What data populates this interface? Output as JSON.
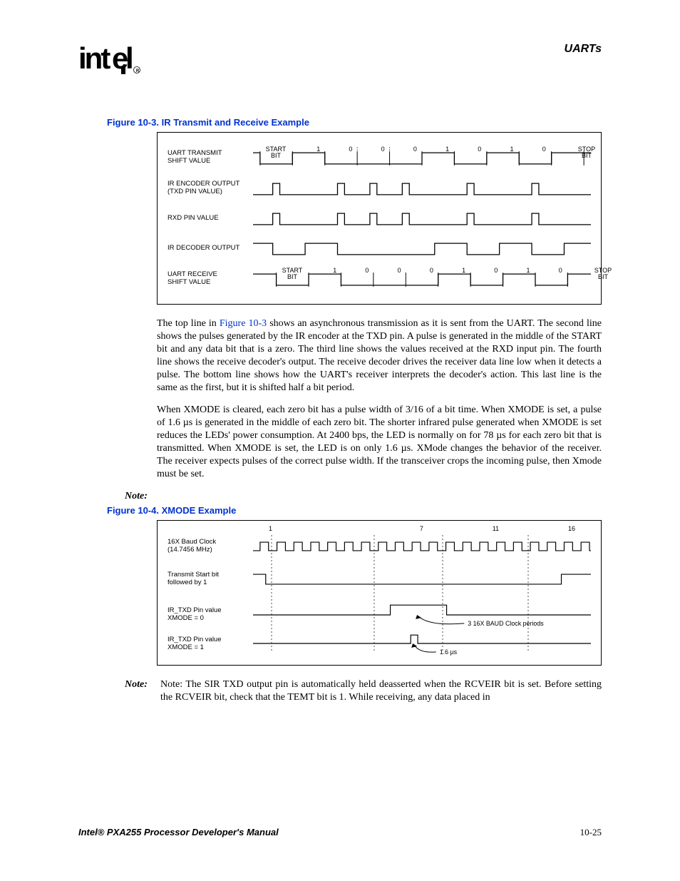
{
  "header": {
    "section": "UARTs",
    "logo_text": "intel",
    "logo_reg": "R"
  },
  "figure103": {
    "caption": "Figure 10-3. IR Transmit and Receive Example",
    "labels": {
      "row1": "UART   TRANSMIT\nSHIFT VALUE",
      "row2": "IR   ENCODER OUTPUT\n(TXD PIN VALUE)",
      "row3": "RXD PIN VALUE",
      "row4": "IR DECODER OUTPUT",
      "row5": "UART RECEIVE\nSHIFT VALUE"
    },
    "bits_top": [
      "START\nBIT",
      "1",
      "0",
      "0",
      "0",
      "1",
      "0",
      "1",
      "0",
      "STOP\nBIT"
    ],
    "bits_bottom": [
      "START\nBIT",
      "1",
      "0",
      "0",
      "0",
      "1",
      "0",
      "1",
      "0",
      "STOP\nBIT"
    ]
  },
  "para1_a": "The top line in ",
  "para1_link": "Figure 10-3",
  "para1_b": " shows an asynchronous transmission as it is sent from the UART. The second line shows the pulses generated by the IR encoder at the TXD pin. A pulse is generated in the middle of the START bit and any data bit that is a zero. The third line shows the values received at the RXD input pin. The fourth line shows the receive decoder's output. The receive decoder drives the receiver data line low when it detects a pulse. The bottom line shows how the UART's receiver interprets the decoder's action. This last line is the same as the first, but it is shifted half a bit period.",
  "para2": "When XMODE is cleared, each zero bit has a pulse width of 3/16 of a bit time. When XMODE is set, a pulse of 1.6 µs is generated in the middle of each zero bit. The shorter infrared pulse generated when XMODE is set reduces the LEDs' power consumption. At 2400 bps, the LED is normally on for 78 µs for each zero bit that is transmitted. When XMODE is set, the LED is on only 1.6 µs. XMode changes the behavior of the receiver. The receiver expects pulses of the correct pulse width. If the transceiver crops the incoming pulse, then Xmode must be set.",
  "note_empty_label": "Note:",
  "figure104": {
    "caption": "Figure 10-4. XMODE Example",
    "ticks": [
      "1",
      "7",
      "11",
      "16"
    ],
    "labels": {
      "row1": "16X Baud Clock\n(14.7456 MHz)",
      "row2": "Transmit Start bit\nfollowed by 1",
      "row3": "IR_TXD Pin value\nXMODE = 0",
      "row4": "IR_TXD Pin value\nXMODE = 1"
    },
    "ann1": "3 16X BAUD Clock periods",
    "ann2": "1.6 µs"
  },
  "note2_label": "Note:",
  "note2_text": "Note: The SIR TXD output pin is automatically held deasserted when the RCVEIR bit is set. Before setting the RCVEIR bit, check that the TEMT bit is 1. While receiving, any data placed in",
  "footer": {
    "title": "Intel® PXA255 Processor Developer's Manual",
    "page": "10-25"
  }
}
